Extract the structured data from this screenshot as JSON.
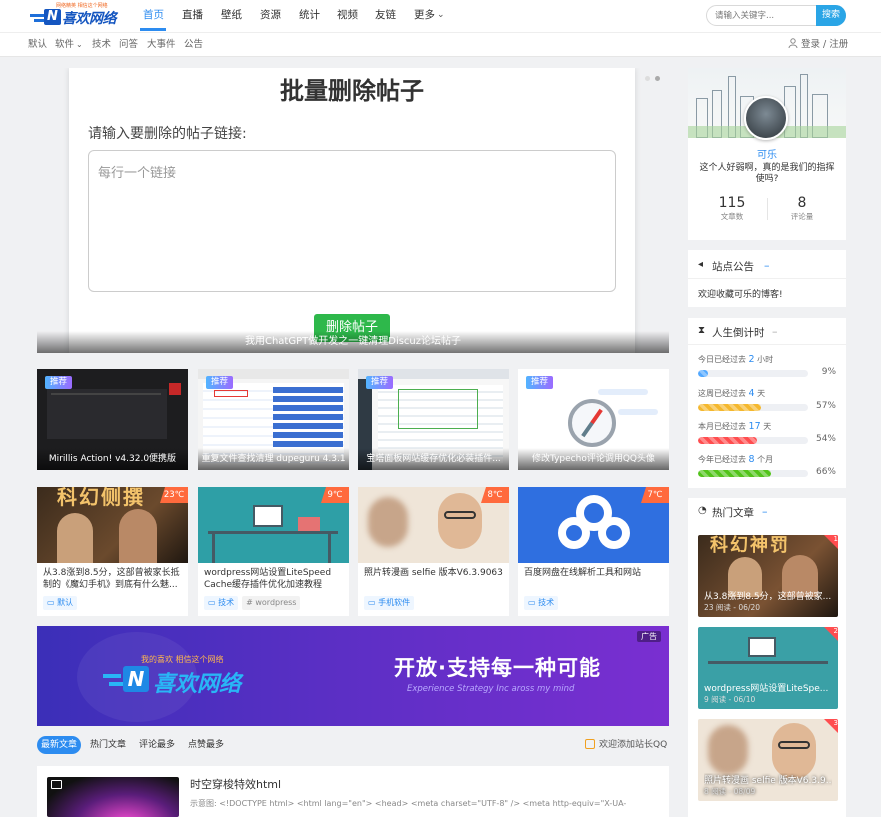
{
  "header": {
    "logo_text": "喜欢网络",
    "logo_tagline": "网络精英  相信这个网络",
    "nav": [
      "首页",
      "直播",
      "壁纸",
      "资源",
      "统计",
      "视频",
      "友链",
      "更多"
    ],
    "search_placeholder": "请输入关键字...",
    "search_button": "搜索"
  },
  "subnav": {
    "items": [
      "默认",
      "软件",
      "技术",
      "问答",
      "大事件",
      "公告"
    ],
    "login": "登录 / 注册"
  },
  "slider": {
    "heading": "批量删除帖子",
    "prompt": "请输入要删除的帖子链接:",
    "placeholder": "每行一个链接",
    "button": "删除帖子",
    "caption": "我用ChatGPT做开发之一键清理Discuz论坛帖子"
  },
  "featured": [
    {
      "badge": "推荐",
      "caption": "Mirillis Action! v4.32.0便携版"
    },
    {
      "badge": "推荐",
      "caption": "重复文件查找清理 dupeguru 4.3.1"
    },
    {
      "badge": "推荐",
      "caption": "宝塔面板网站缓存优化必装插件..."
    },
    {
      "badge": "推荐",
      "caption": "修改Typecho评论调用QQ头像"
    }
  ],
  "posts": [
    {
      "temp": "23℃",
      "title": "从3.8涨到8.5分，这部曾被家长抵制的《魔幻手机》到底有什么魅...",
      "tags": [
        "默认"
      ],
      "thumb_text": "科幻侧撰"
    },
    {
      "temp": "9℃",
      "title": "wordpress网站设置LiteSpeed Cache缓存插件优化加速教程",
      "tags": [
        "技术",
        "# wordpress"
      ]
    },
    {
      "temp": "8℃",
      "title": "照片转漫画 selfie 版本V6.3.9063",
      "tags": [
        "手机软件"
      ]
    },
    {
      "temp": "7℃",
      "title": "百度网盘在线解析工具和网站",
      "tags": [
        "技术"
      ]
    }
  ],
  "banner": {
    "ad_label": "广告",
    "logo_text": "喜欢网络",
    "logo_small": "我的喜欢  相信这个网络",
    "slogan": "开放·支持每一种可能",
    "sub": "Experience Strategy Inc aross my mind"
  },
  "tabs": {
    "items": [
      "最新文章",
      "热门文章",
      "评论最多",
      "点赞最多"
    ],
    "qq_link": "欢迎添加站长QQ"
  },
  "latest": {
    "title": "时空穿梭特效html",
    "excerpt": "示意图: <!DOCTYPE html> <html lang=\"en\"> <head> <meta charset=\"UTF-8\" /> <meta http-equiv=\"X-UA-"
  },
  "profile": {
    "name": "可乐",
    "bio": "这个人好弱啊，真的是我们的指挥使吗?",
    "stats": [
      {
        "num": "115",
        "label": "文章数"
      },
      {
        "num": "8",
        "label": "评论量"
      }
    ]
  },
  "notice": {
    "title": "站点公告",
    "text": "欢迎收藏可乐的博客!"
  },
  "countdown": {
    "title": "人生倒计时",
    "rows": [
      {
        "label": "今日已经过去",
        "value": "2",
        "unit": "小时",
        "pct": "9%",
        "fraction": 0.09,
        "color": "#52a8ff"
      },
      {
        "label": "这周已经过去",
        "value": "4",
        "unit": "天",
        "pct": "57%",
        "fraction": 0.57,
        "color": "#f5b82e"
      },
      {
        "label": "本月已经过去",
        "value": "17",
        "unit": "天",
        "pct": "54%",
        "fraction": 0.54,
        "color": "#ff4d4f"
      },
      {
        "label": "今年已经过去",
        "value": "8",
        "unit": "个月",
        "pct": "66%",
        "fraction": 0.66,
        "color": "#52c41a"
      }
    ]
  },
  "hot": {
    "title": "热门文章",
    "items": [
      {
        "rank": "1",
        "title": "从3.8涨到8.5分，这部曾被家...",
        "meta": "23 阅读 - 06/20",
        "thumb_text": "科幻神罚"
      },
      {
        "rank": "2",
        "title": "wordpress网站设置LiteSpe...",
        "meta": "9 阅读 - 06/10"
      },
      {
        "rank": "3",
        "title": "照片转漫画 selfie 版本V6.3.9...",
        "meta": "8 阅读 - 08/09"
      }
    ]
  }
}
